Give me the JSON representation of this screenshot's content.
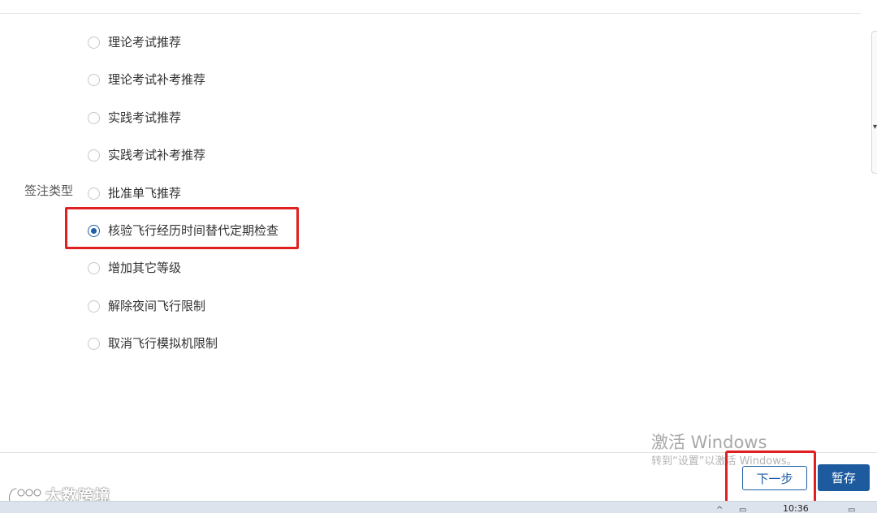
{
  "form": {
    "field_label": "签注类型",
    "options": [
      {
        "label": "理论考试推荐",
        "selected": false
      },
      {
        "label": "理论考试补考推荐",
        "selected": false
      },
      {
        "label": "实践考试推荐",
        "selected": false
      },
      {
        "label": "实践考试补考推荐",
        "selected": false
      },
      {
        "label": "批准单飞推荐",
        "selected": false
      },
      {
        "label": "核验飞行经历时间替代定期检查",
        "selected": true
      },
      {
        "label": "增加其它等级",
        "selected": false
      },
      {
        "label": "解除夜间飞行限制",
        "selected": false
      },
      {
        "label": "取消飞行模拟机限制",
        "selected": false
      }
    ]
  },
  "footer": {
    "next_label": "下一步",
    "save_label": "暂存"
  },
  "watermark": {
    "title": "激活 Windows",
    "subtitle": "转到“设置”以激活 Windows。"
  },
  "brand": {
    "text": "大数跨境"
  },
  "taskbar": {
    "time": "10:36"
  },
  "colors": {
    "accent": "#1f5fa8",
    "primary_button": "#1d5a9e",
    "highlight": "#e02020"
  }
}
